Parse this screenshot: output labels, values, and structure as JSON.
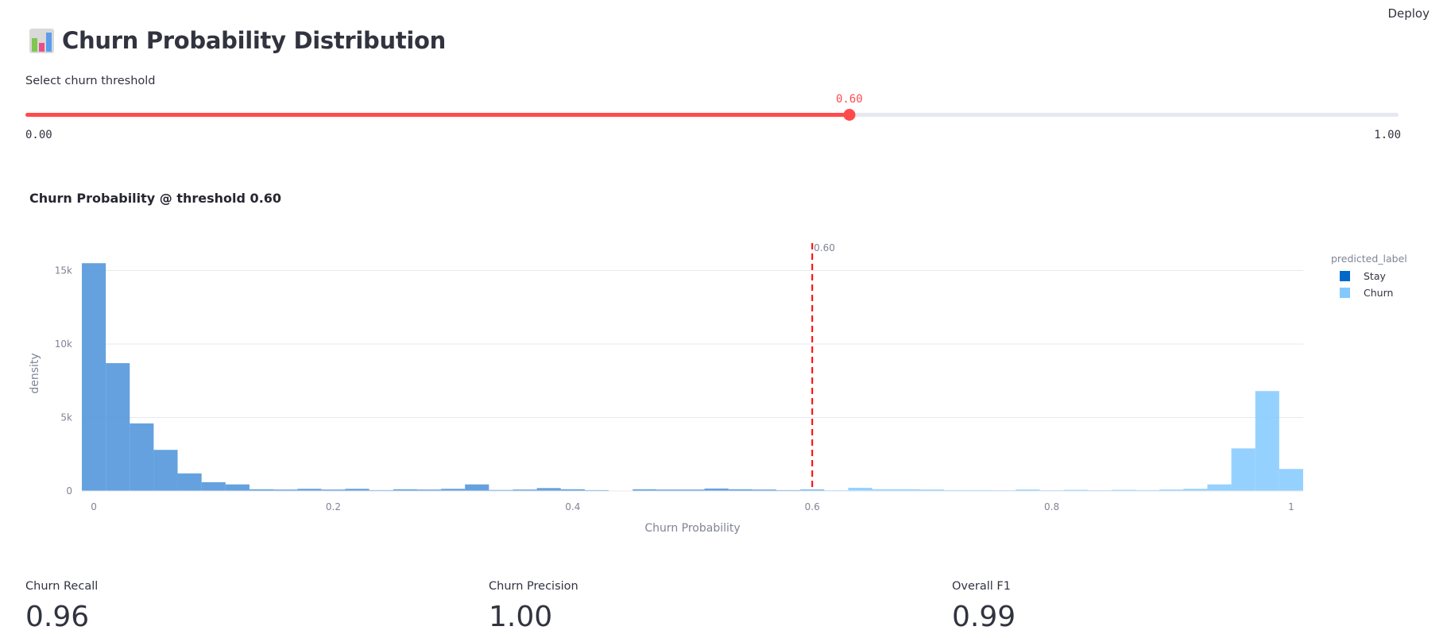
{
  "header": {
    "deploy_label": "Deploy"
  },
  "page": {
    "title": "Churn Probability Distribution"
  },
  "slider": {
    "label": "Select churn threshold",
    "value": 0.6,
    "value_text": "0.60",
    "min_text": "0.00",
    "max_text": "1.00",
    "accent": "#ff4b4b"
  },
  "chart_title": "Churn Probability @ threshold 0.60",
  "chart_data": {
    "type": "bar",
    "xlabel": "Churn Probability",
    "ylabel": "density",
    "xlim": [
      -0.01,
      1.01
    ],
    "ylim": [
      0,
      16000
    ],
    "x_ticks": [
      0,
      0.2,
      0.4,
      0.6,
      0.8,
      1
    ],
    "x_tick_labels": [
      "0",
      "0.2",
      "0.4",
      "0.6",
      "0.8",
      "1"
    ],
    "y_ticks": [
      0,
      5000,
      10000,
      15000
    ],
    "y_tick_labels": [
      "0",
      "5k",
      "10k",
      "15k"
    ],
    "bin_width": 0.02,
    "legend_title": "predicted_label",
    "legend_position": "top-right",
    "series": [
      {
        "name": "Stay",
        "color": "#4a90d9",
        "legend_color": "#0068c9",
        "bin_starts": [
          -0.01,
          0.01,
          0.03,
          0.05,
          0.07,
          0.09,
          0.11,
          0.13,
          0.15,
          0.17,
          0.19,
          0.21,
          0.23,
          0.25,
          0.27,
          0.29,
          0.31,
          0.33,
          0.35,
          0.37,
          0.39,
          0.41,
          0.43,
          0.45,
          0.47,
          0.49,
          0.51,
          0.53,
          0.55,
          0.57,
          0.59
        ],
        "values": [
          15500,
          8700,
          4600,
          2800,
          1200,
          600,
          450,
          120,
          100,
          150,
          100,
          150,
          60,
          120,
          100,
          150,
          450,
          70,
          100,
          200,
          120,
          60,
          0,
          120,
          100,
          100,
          170,
          120,
          100,
          60,
          100
        ]
      },
      {
        "name": "Churn",
        "color": "#83c9ff",
        "legend_color": "#83c9ff",
        "bin_starts": [
          0.59,
          0.61,
          0.63,
          0.65,
          0.67,
          0.69,
          0.71,
          0.73,
          0.75,
          0.77,
          0.79,
          0.81,
          0.83,
          0.85,
          0.87,
          0.89,
          0.91,
          0.93,
          0.95,
          0.97,
          0.99
        ],
        "values": [
          60,
          50,
          220,
          120,
          120,
          100,
          60,
          60,
          50,
          100,
          50,
          80,
          50,
          80,
          60,
          100,
          150,
          450,
          2900,
          6800,
          1500
        ]
      }
    ],
    "threshold": {
      "x": 0.6,
      "label": "0.60",
      "color": "#ff0000"
    },
    "grid": true
  },
  "metrics": [
    {
      "label": "Churn Recall",
      "value": "0.96"
    },
    {
      "label": "Churn Precision",
      "value": "1.00"
    },
    {
      "label": "Overall F1",
      "value": "0.99"
    }
  ]
}
